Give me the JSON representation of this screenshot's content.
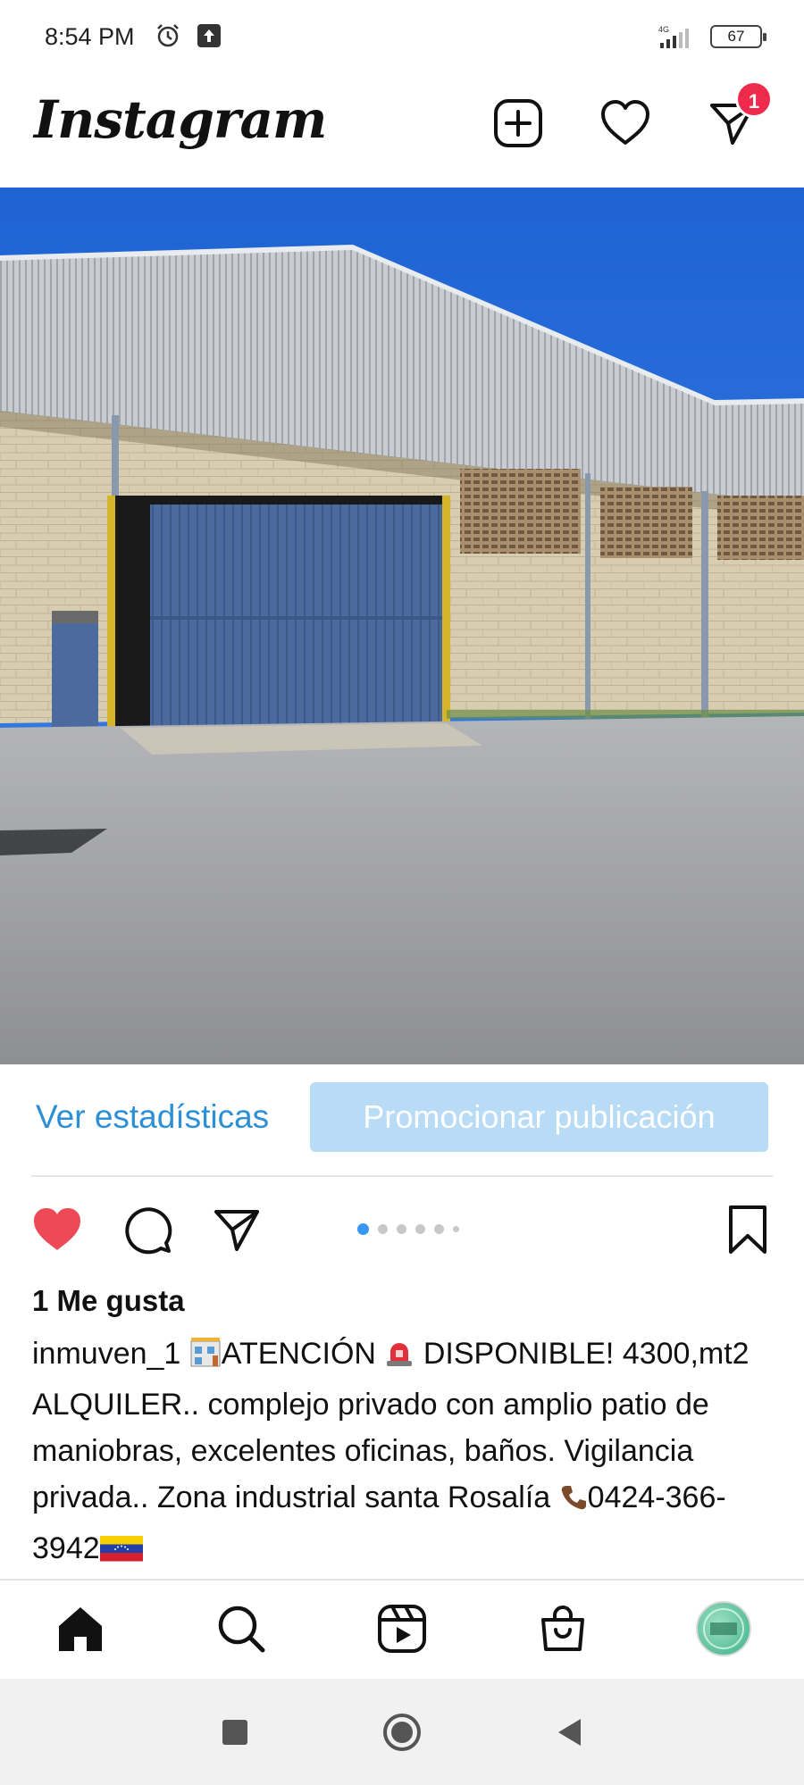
{
  "status_bar": {
    "time": "8:54 PM",
    "network": "4G",
    "battery": "67"
  },
  "header": {
    "logo": "Instagram",
    "notification_count": "1",
    "icons": [
      "new-post-icon",
      "heart-icon",
      "direct-message-icon"
    ]
  },
  "promotion": {
    "stats_label": "Ver estadísticas",
    "promote_label": "Promocionar publicación",
    "promote_color": "#b8dcf5",
    "link_color": "#2d8fd5"
  },
  "post": {
    "liked": true,
    "like_color": "#ed4956",
    "carousel_index": 1,
    "carousel_count": 6,
    "likes_text": "1 Me gusta",
    "username": "inmuven_1",
    "caption_part1": "ATENCIÓN",
    "caption_part2": "DISPONIBLE! 4300,mt2 ALQUILER.. complejo privado con amplio patio de maniobras, excelentes oficinas, baños. Vigilancia privada.. Zona industrial santa Rosalía",
    "phone": "0424-366-3942"
  },
  "bottom_nav": {
    "items": [
      "home-icon",
      "search-icon",
      "reels-icon",
      "shop-icon",
      "profile-avatar"
    ]
  },
  "system_nav": {
    "items": [
      "recents-button",
      "home-button",
      "back-button"
    ]
  }
}
